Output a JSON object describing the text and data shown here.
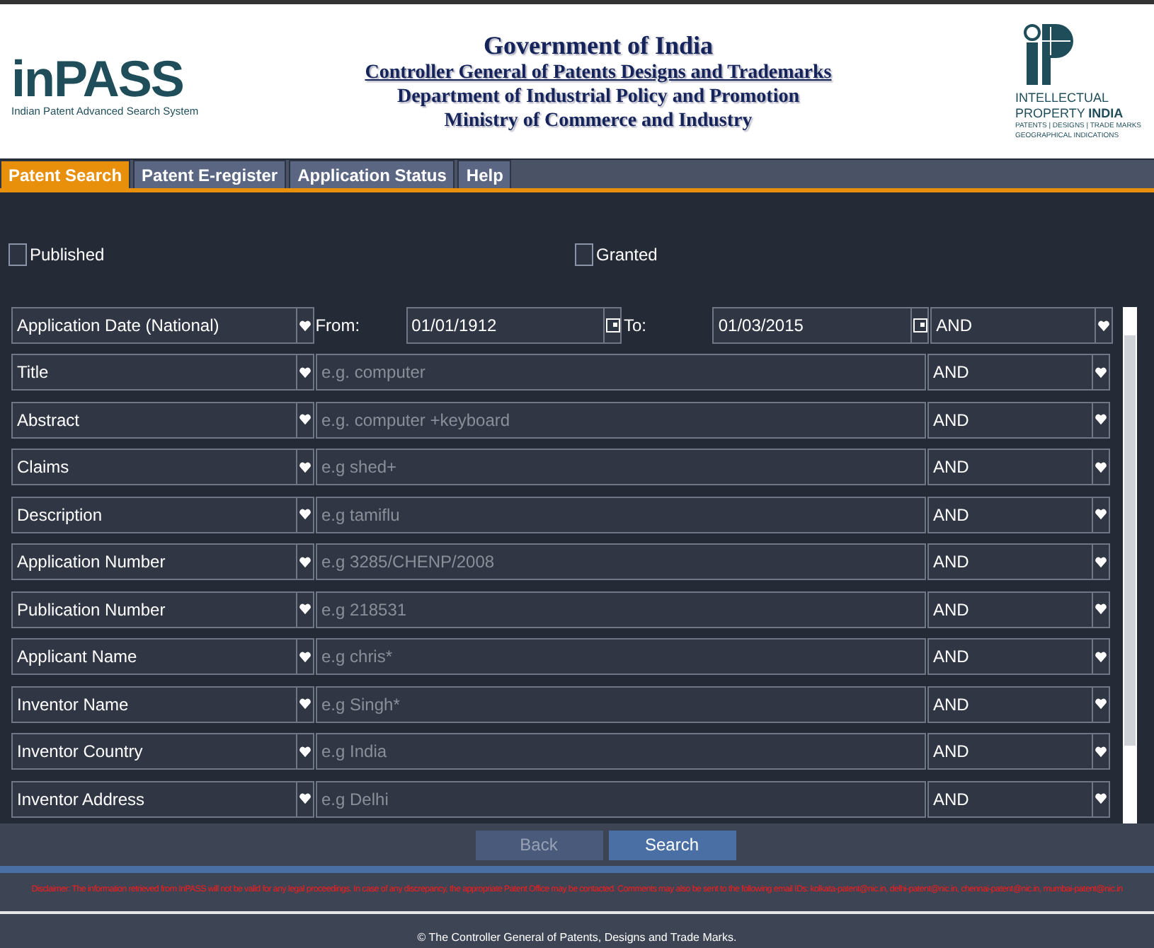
{
  "header": {
    "logo_text": "inPASS",
    "logo_caption": "Indian Patent Advanced Search System",
    "title": "Government of India",
    "org_link": "Controller General of Patents Designs and Trademarks",
    "lines": [
      "Department of Industrial Policy and Promotion",
      "Ministry of Commerce and Industry"
    ],
    "ip_lines": [
      {
        "text": "INTELLECTUAL",
        "kind": "plain"
      },
      {
        "text": "PROPERTY **INDIA**",
        "kind": "plain"
      },
      {
        "text": "PATENTS | DESIGNS | TRADE MARKS",
        "kind": "small"
      },
      {
        "text": "GEOGRAPHICAL INDICATIONS",
        "kind": "small"
      }
    ]
  },
  "tabs": [
    {
      "label": "Patent Search",
      "selected": true
    },
    {
      "label": "Patent E-register",
      "selected": false
    },
    {
      "label": "Application Status",
      "selected": false
    },
    {
      "label": "Help",
      "selected": false
    }
  ],
  "filters": [
    {
      "label": "Published",
      "checked": false
    },
    {
      "label": "Granted",
      "checked": false
    }
  ],
  "rows": [
    {
      "kind": "date",
      "field": "Application Date (National)",
      "from_label": "From:",
      "from": "01/01/1912",
      "to_label": "To:",
      "to": "01/03/2015",
      "operator": "AND"
    },
    {
      "kind": "text",
      "field": "Title",
      "placeholder": "e.g. computer",
      "operator": "AND"
    },
    {
      "kind": "text",
      "field": "Abstract",
      "placeholder": "e.g. computer +keyboard",
      "operator": "AND"
    },
    {
      "kind": "text",
      "field": "Claims",
      "placeholder": "e.g shed+",
      "operator": "AND"
    },
    {
      "kind": "text",
      "field": "Description",
      "placeholder": "e.g tamiflu",
      "operator": "AND"
    },
    {
      "kind": "text",
      "field": "Application Number",
      "placeholder": "e.g 3285/CHENP/2008",
      "operator": "AND"
    },
    {
      "kind": "text",
      "field": "Publication Number",
      "placeholder": "e.g 218531",
      "operator": "AND"
    },
    {
      "kind": "text",
      "field": "Applicant Name",
      "placeholder": "e.g chris*",
      "operator": "AND"
    },
    {
      "kind": "text",
      "field": "Inventor Name",
      "placeholder": "e.g Singh*",
      "operator": "AND"
    },
    {
      "kind": "text",
      "field": "Inventor Country",
      "placeholder": "e.g India",
      "operator": "AND"
    },
    {
      "kind": "text",
      "field": "Inventor Address",
      "placeholder": "e.g Delhi",
      "operator": "AND"
    }
  ],
  "buttons": [
    {
      "label": "Back",
      "disabled": true
    },
    {
      "label": "Search",
      "disabled": false
    }
  ],
  "disclaimer": "Disclaimer: The information retrieved from InPASS will not be valid for any legal proceedings. In case of any discrepancy, the appropriate Patent Office may be contacted. Comments may also be sent to the following email IDs: kolkata-patent@nic.in, delhi-patent@nic.in, chennai-patent@nic.in, mumbai-patent@nic.in",
  "footer": "© The Controller General of Patents, Designs and Trade Marks."
}
